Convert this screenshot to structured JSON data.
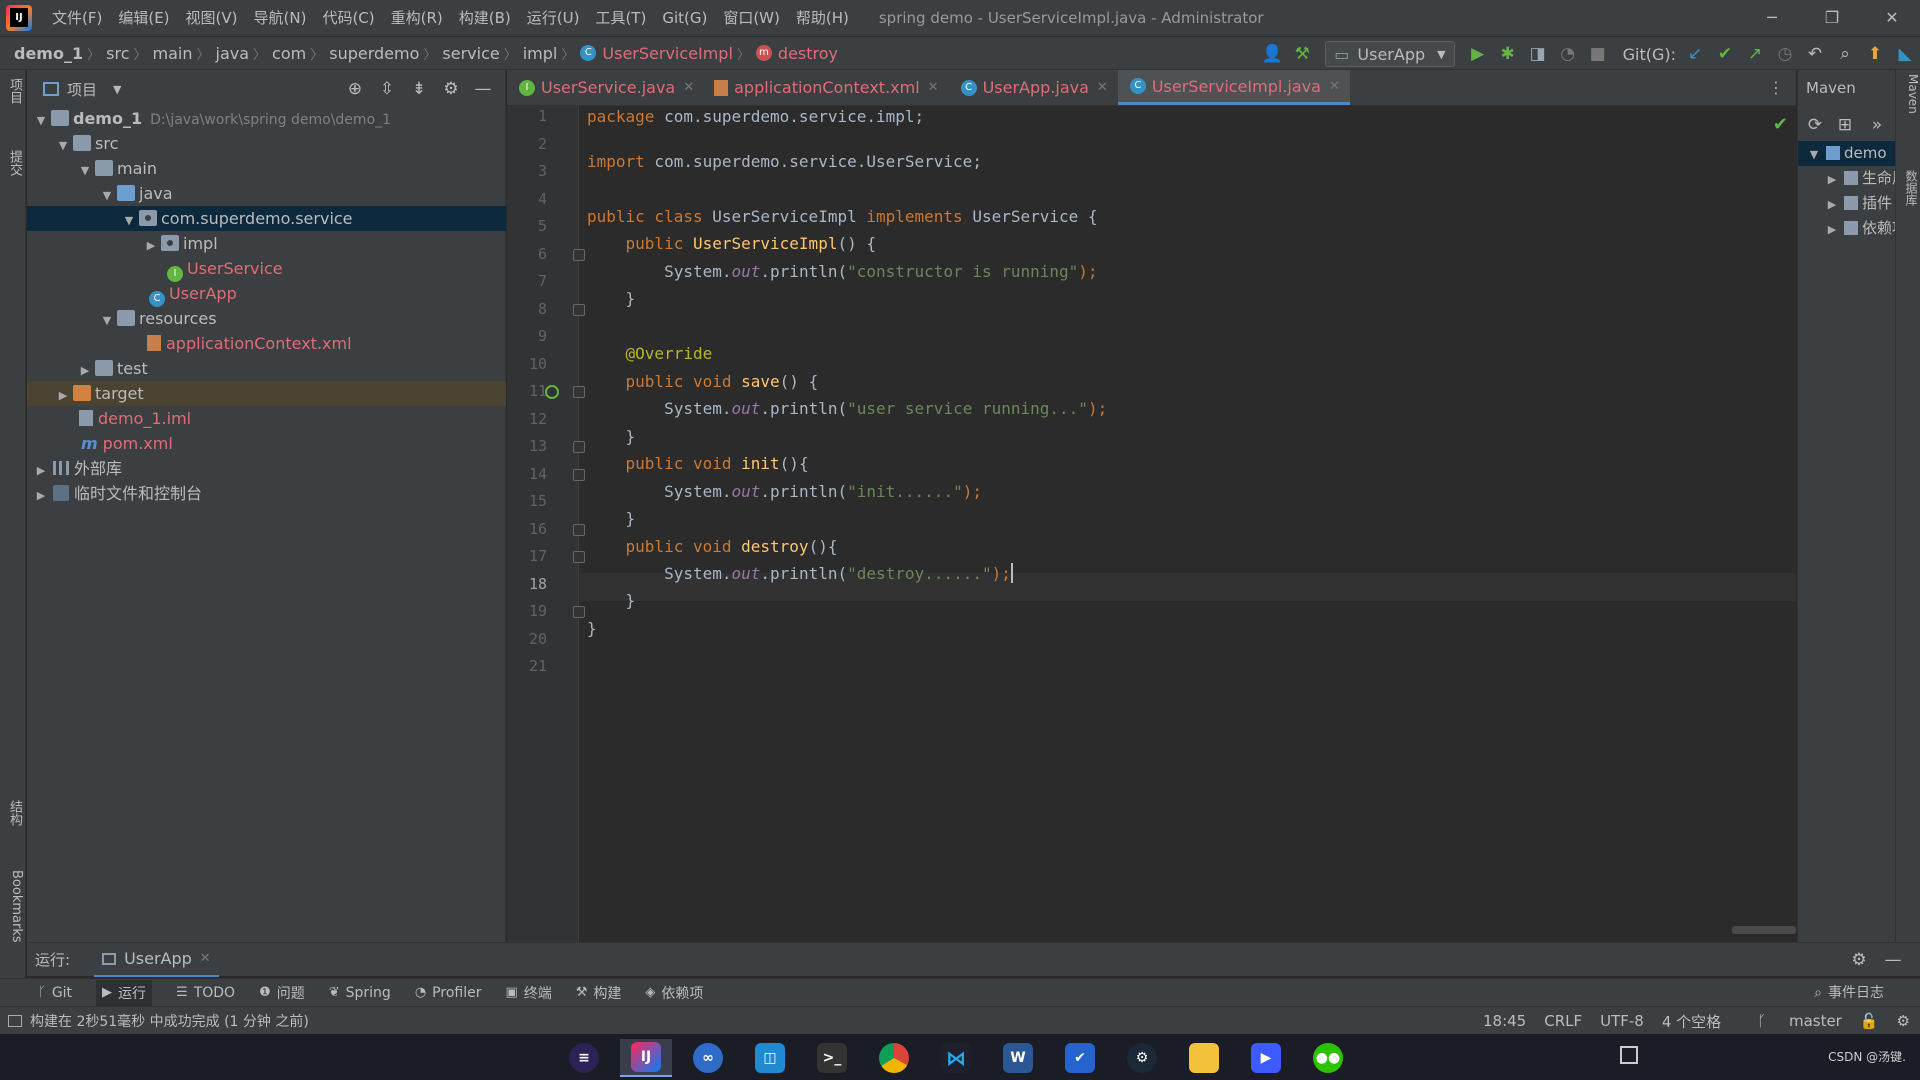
{
  "menubar": {
    "items": [
      "文件(F)",
      "编辑(E)",
      "视图(V)",
      "导航(N)",
      "代码(C)",
      "重构(R)",
      "构建(B)",
      "运行(U)",
      "工具(T)",
      "Git(G)",
      "窗口(W)",
      "帮助(H)"
    ],
    "window_title": "spring demo - UserServiceImpl.java - Administrator"
  },
  "breadcrumb": {
    "items": [
      "demo_1",
      "src",
      "main",
      "java",
      "com",
      "superdemo",
      "service",
      "impl"
    ],
    "class_name": "UserServiceImpl",
    "method_name": "destroy"
  },
  "toolbar": {
    "run_config": "UserApp",
    "git_label": "Git(G):"
  },
  "left_strip": {
    "tab_project": "项目",
    "tab_commit": "提交",
    "tab_structure": "结构",
    "tab_bookmarks": "Bookmarks"
  },
  "project": {
    "title": "项目",
    "tree": [
      {
        "label": "demo_1",
        "path": "D:\\java\\work\\spring demo\\demo_1"
      },
      {
        "label": "src"
      },
      {
        "label": "main"
      },
      {
        "label": "java"
      },
      {
        "label": "com.superdemo.service"
      },
      {
        "label": "impl"
      },
      {
        "label": "UserService"
      },
      {
        "label": "UserApp"
      },
      {
        "label": "resources"
      },
      {
        "label": "applicationContext.xml"
      },
      {
        "label": "test"
      },
      {
        "label": "target"
      },
      {
        "label": "demo_1.iml"
      },
      {
        "label": "pom.xml"
      },
      {
        "label": "外部库"
      },
      {
        "label": "临时文件和控制台"
      }
    ]
  },
  "editor_tabs": [
    {
      "label": "UserService.java",
      "icon": "interface-icon"
    },
    {
      "label": "applicationContext.xml",
      "icon": "xml-file-icon"
    },
    {
      "label": "UserApp.java",
      "icon": "class-icon"
    },
    {
      "label": "UserServiceImpl.java",
      "icon": "class-icon",
      "active": true
    }
  ],
  "editor": {
    "current_line": 18,
    "line_numbers": [
      "1",
      "2",
      "3",
      "4",
      "5",
      "6",
      "7",
      "8",
      "9",
      "10",
      "11",
      "12",
      "13",
      "14",
      "15",
      "16",
      "17",
      "18",
      "19",
      "20",
      "21"
    ],
    "code": {
      "l1_kw": "package",
      "l1_rest": " com.superdemo.service.impl;",
      "l3_kw": "import",
      "l3_rest": " com.superdemo.service.UserService;",
      "l5_kw1": "public class",
      "l5_name": " UserServiceImpl ",
      "l5_kw2": "implements",
      "l5_rest": " UserService {",
      "l6_kw": "    public",
      "l6_fn": " UserServiceImpl",
      "l6_rest": "() {",
      "sys": "        System.",
      "out": "out",
      "println": ".println(",
      "l7_str": "\"constructor is running\"",
      "close_call": ");",
      "brace_close": "    }",
      "l10_ann": "    @Override",
      "pub_void": "    public void",
      "l11_fn": " save",
      "l11_rest": "() {",
      "l12_str": "\"user service running...\"",
      "l14_fn": " init",
      "l14_rest": "(){",
      "l15_str": "\"init......\"",
      "l17_fn": " destroy",
      "l17_rest": "(){",
      "l18_str": "\"destroy......\"",
      "l20": "}"
    }
  },
  "maven": {
    "title": "Maven",
    "root": "demo",
    "items": [
      "生命周期",
      "插件",
      "依赖项"
    ],
    "side_label": "Maven",
    "db_label": "数据库"
  },
  "run_bar": {
    "label": "运行:",
    "tab": "UserApp"
  },
  "tool_windows": [
    "Git",
    "运行",
    "TODO",
    "问题",
    "Spring",
    "Profiler",
    "终端",
    "构建",
    "依赖项"
  ],
  "event_log": "事件日志",
  "status": {
    "message": "构建在 2秒51毫秒 中成功完成 (1 分钟 之前)",
    "position": "18:45",
    "line_sep": "CRLF",
    "encoding": "UTF-8",
    "indent": "4 个空格",
    "branch": "master"
  },
  "taskbar": {
    "watermark": "CSDN @汤键."
  }
}
